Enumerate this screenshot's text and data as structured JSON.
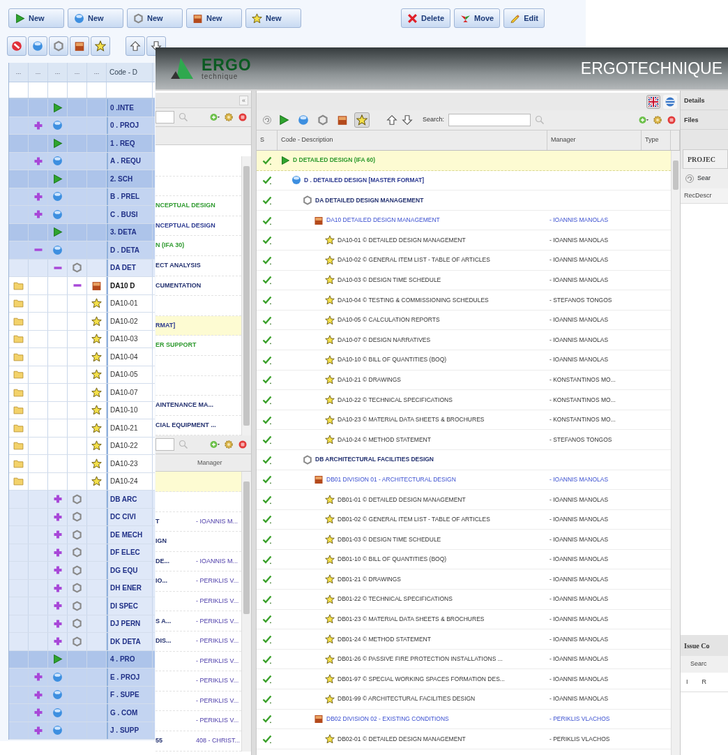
{
  "back_window": {
    "new_buttons": [
      {
        "kind": "phase",
        "label": "New"
      },
      {
        "kind": "group",
        "label": "New"
      },
      {
        "kind": "section",
        "label": "New"
      },
      {
        "kind": "package",
        "label": "New"
      },
      {
        "kind": "item",
        "label": "New"
      }
    ],
    "action_buttons": [
      {
        "kind": "delete",
        "label": "Delete"
      },
      {
        "kind": "move",
        "label": "Move"
      },
      {
        "kind": "edit",
        "label": "Edit"
      }
    ],
    "filter_buttons": [
      {
        "kind": "stop"
      },
      {
        "kind": "group"
      },
      {
        "kind": "section"
      },
      {
        "kind": "package"
      },
      {
        "kind": "item"
      }
    ],
    "order_buttons": [
      {
        "kind": "up"
      },
      {
        "kind": "down"
      }
    ],
    "grid": {
      "columns": [
        "...",
        "...",
        "...",
        "...",
        "...",
        "Code - D"
      ],
      "rows": [
        {
          "kind": "phase",
          "text": "0 .INTE"
        },
        {
          "kind": "group",
          "text": "0 . PROJ",
          "expanded": false
        },
        {
          "kind": "phase",
          "text": "1 . REQ"
        },
        {
          "kind": "group",
          "text": "A . REQU",
          "expanded": false
        },
        {
          "kind": "phase",
          "text": "2. SCH"
        },
        {
          "kind": "group",
          "text": "B . PREL",
          "expanded": false
        },
        {
          "kind": "group",
          "text": "C . BUSI",
          "expanded": false
        },
        {
          "kind": "phase",
          "text": "3. DETA"
        },
        {
          "kind": "group",
          "text": "D . DETA",
          "expanded": true,
          "children": [
            {
              "kind": "section",
              "text": "DA DET",
              "expanded": true,
              "children": [
                {
                  "kind": "package",
                  "text": "DA10 D",
                  "expanded": true,
                  "children": [
                    {
                      "kind": "item",
                      "text": "DA10-01"
                    },
                    {
                      "kind": "item",
                      "text": "DA10-02"
                    },
                    {
                      "kind": "item",
                      "text": "DA10-03"
                    },
                    {
                      "kind": "item",
                      "text": "DA10-04"
                    },
                    {
                      "kind": "item",
                      "text": "DA10-05"
                    },
                    {
                      "kind": "item",
                      "text": "DA10-07"
                    },
                    {
                      "kind": "item",
                      "text": "DA10-10"
                    },
                    {
                      "kind": "item",
                      "text": "DA10-21"
                    },
                    {
                      "kind": "item",
                      "text": "DA10-22"
                    },
                    {
                      "kind": "item",
                      "text": "DA10-23"
                    },
                    {
                      "kind": "item",
                      "text": "DA10-24"
                    }
                  ]
                }
              ]
            },
            {
              "kind": "section",
              "text": "DB ARC",
              "expanded": false
            },
            {
              "kind": "section",
              "text": "DC CIVI",
              "expanded": false
            },
            {
              "kind": "section",
              "text": "DE MECH",
              "expanded": false
            },
            {
              "kind": "section",
              "text": "DF ELEC",
              "expanded": false
            },
            {
              "kind": "section",
              "text": "DG EQU",
              "expanded": false
            },
            {
              "kind": "section",
              "text": "DH ENER",
              "expanded": false
            },
            {
              "kind": "section",
              "text": "DI SPEC",
              "expanded": false
            },
            {
              "kind": "section",
              "text": "DJ PERN",
              "expanded": false
            },
            {
              "kind": "section",
              "text": "DK DETA",
              "expanded": false
            }
          ]
        },
        {
          "kind": "phase",
          "text": "4 . PRO"
        },
        {
          "kind": "group",
          "text": "E . PROJ",
          "expanded": false
        },
        {
          "kind": "group",
          "text": "F . SUPE",
          "expanded": false
        },
        {
          "kind": "group",
          "text": "G . COM",
          "expanded": false
        },
        {
          "kind": "group",
          "text": "J . SUPP",
          "expanded": false
        }
      ]
    }
  },
  "front_window": {
    "brand": {
      "logo_word": "ERGO",
      "logo_subword": "technique",
      "title": "ERGOTECHNIQUE"
    },
    "tree_panel": {
      "collapse_label": "«",
      "rows": [
        {
          "selected": false
        },
        {
          "selected": false
        },
        {
          "kind": "phase",
          "text": "NCEPTUAL DESIGN",
          "selected": false
        },
        {
          "kind": "group",
          "text": "NCEPTUAL DESIGN",
          "selected": false
        },
        {
          "kind": "phase",
          "text": "N (IFA 30)",
          "selected": false
        },
        {
          "kind": "section",
          "text": "ECT ANALYSIS",
          "selected": false
        },
        {
          "kind": "section",
          "text": "CUMENTATION",
          "selected": false
        },
        {
          "selected": false
        },
        {
          "kind": "group",
          "text": "RMAT]",
          "selected": true
        },
        {
          "kind": "phase",
          "text": "ER SUPPORT",
          "selected": false
        },
        {
          "selected": false
        },
        {
          "selected": false
        },
        {
          "kind": "section",
          "text": "AINTENANCE MA...",
          "selected": false
        },
        {
          "kind": "section",
          "text": "CIAL EQUIPMENT ...",
          "selected": false
        }
      ]
    },
    "list_panel": {
      "columns": [
        "Manager"
      ],
      "rows": [
        {
          "selected": true
        },
        {
          "selected": false
        },
        {
          "code": "T",
          "manager": "- IOANNIS M...",
          "selected": false
        },
        {
          "code": "IGN",
          "selected": false
        },
        {
          "code": "DE...",
          "manager": "- IOANNIS M...",
          "selected": false
        },
        {
          "code": "IO...",
          "manager": "- PERIKLIS V...",
          "selected": false
        },
        {
          "manager": "- PERIKLIS V...",
          "selected": false
        },
        {
          "code": "S A...",
          "manager": "- PERIKLIS V...",
          "selected": false
        },
        {
          "code": "DIS...",
          "manager": "- PERIKLIS V...",
          "selected": false
        },
        {
          "manager": "- PERIKLIS V...",
          "selected": false
        },
        {
          "manager": "- PERIKLIS V...",
          "selected": false
        },
        {
          "manager": "- PERIKLIS V...",
          "selected": false
        },
        {
          "manager": "- PERIKLIS V...",
          "selected": false
        },
        {
          "code": "55",
          "manager": "408 - CHRIST...",
          "selected": false
        }
      ]
    },
    "main_panel": {
      "languages": [
        {
          "kind": "uk",
          "selected": true
        },
        {
          "kind": "gr",
          "selected": false
        }
      ],
      "filter_buttons": [
        {
          "kind": "phase",
          "selected": false
        },
        {
          "kind": "group",
          "selected": false
        },
        {
          "kind": "section",
          "selected": false
        },
        {
          "kind": "package",
          "selected": false
        },
        {
          "kind": "item",
          "selected": true
        }
      ],
      "order_buttons": [
        {
          "kind": "up"
        },
        {
          "kind": "down"
        }
      ],
      "search": {
        "label": "Search:"
      },
      "columns": [
        "S",
        "Code - Description",
        "Manager",
        "Type"
      ],
      "rows": [
        {
          "kind": "phase",
          "text": "D DETAILED DESIGN (IFA 60)",
          "done": true,
          "selected": true,
          "children": [
            {
              "kind": "group",
              "text": "D . DETAILED DESIGN [MASTER FORMAT]",
              "done": true,
              "selected": false,
              "children": [
                {
                  "kind": "section",
                  "text": "DA DETAILED DESIGN MANAGEMENT",
                  "done": true,
                  "selected": false,
                  "children": [
                    {
                      "kind": "package",
                      "text": "DA10 DETAILED DESIGN MANAGEMENT",
                      "manager": "- IOANNIS MANOLAS",
                      "done": true,
                      "selected": false,
                      "children": [
                        {
                          "kind": "item",
                          "text": "DA10-01 © DETAILED DESIGN MANAGEMENT",
                          "manager": "- IOANNIS MANOLAS",
                          "done": true,
                          "selected": false
                        },
                        {
                          "kind": "item",
                          "text": "DA10-02 © GENERAL ITEM LIST - TABLE OF ARTICLES",
                          "manager": "- IOANNIS MANOLAS",
                          "done": true,
                          "selected": false
                        },
                        {
                          "kind": "item",
                          "text": "DA10-03 © DESIGN TIME SCHEDULE",
                          "manager": "- IOANNIS MANOLAS",
                          "done": true,
                          "selected": false
                        },
                        {
                          "kind": "item",
                          "text": "DA10-04 © TESTING & COMMISSIONING SCHEDULES",
                          "manager": "- STEFANOS TONGOS",
                          "done": true,
                          "selected": false
                        },
                        {
                          "kind": "item",
                          "text": "DA10-05 © CALCULATION REPORTS",
                          "manager": "- IOANNIS MANOLAS",
                          "done": true,
                          "selected": false
                        },
                        {
                          "kind": "item",
                          "text": "DA10-07 © DESIGN NARRATIVES",
                          "manager": "- IOANNIS MANOLAS",
                          "done": true,
                          "selected": false
                        },
                        {
                          "kind": "item",
                          "text": "DA10-10 © BILL OF QUANTITIES (BOQ)",
                          "manager": "- IOANNIS MANOLAS",
                          "done": true,
                          "selected": false
                        },
                        {
                          "kind": "item",
                          "text": "DA10-21 © DRAWINGS",
                          "manager": "- KONSTANTINOS MO...",
                          "done": true,
                          "selected": false
                        },
                        {
                          "kind": "item",
                          "text": "DA10-22 © TECHNICAL SPECIFICATIONS",
                          "manager": "- KONSTANTINOS MO...",
                          "done": true,
                          "selected": false
                        },
                        {
                          "kind": "item",
                          "text": "DA10-23 © MATERIAL DATA SHEETS & BROCHURES",
                          "manager": "- KONSTANTINOS MO...",
                          "done": true,
                          "selected": false
                        },
                        {
                          "kind": "item",
                          "text": "DA10-24 © METHOD STATEMENT",
                          "manager": "- STEFANOS TONGOS",
                          "done": true,
                          "selected": false
                        }
                      ]
                    }
                  ]
                },
                {
                  "kind": "section",
                  "text": "DB ARCHITECTURAL FACILITIES DESIGN",
                  "done": true,
                  "selected": false,
                  "children": [
                    {
                      "kind": "package",
                      "text": "DB01 DIVISION 01 - ARCHITECTURAL DESIGN",
                      "manager": "- IOANNIS MANOLAS",
                      "done": true,
                      "selected": false,
                      "children": [
                        {
                          "kind": "item",
                          "text": "DB01-01 © DETAILED DESIGN MANAGEMENT",
                          "manager": "- IOANNIS MANOLAS",
                          "done": true,
                          "selected": false
                        },
                        {
                          "kind": "item",
                          "text": "DB01-02 © GENERAL ITEM LIST - TABLE OF ARTICLES",
                          "manager": "- IOANNIS MANOLAS",
                          "done": true,
                          "selected": false
                        },
                        {
                          "kind": "item",
                          "text": "DB01-03 © DESIGN TIME SCHEDULE",
                          "manager": "- IOANNIS MANOLAS",
                          "done": true,
                          "selected": false
                        },
                        {
                          "kind": "item",
                          "text": "DB01-10 © BILL OF QUANTITIES (BOQ)",
                          "manager": "- IOANNIS MANOLAS",
                          "done": true,
                          "selected": false
                        },
                        {
                          "kind": "item",
                          "text": "DB01-21 © DRAWINGS",
                          "manager": "- IOANNIS MANOLAS",
                          "done": true,
                          "selected": false
                        },
                        {
                          "kind": "item",
                          "text": "DB01-22 © TECHNICAL SPECIFICATIONS",
                          "manager": "- IOANNIS MANOLAS",
                          "done": true,
                          "selected": false
                        },
                        {
                          "kind": "item",
                          "text": "DB01-23 © MATERIAL DATA SHEETS & BROCHURES",
                          "manager": "- IOANNIS MANOLAS",
                          "done": true,
                          "selected": false
                        },
                        {
                          "kind": "item",
                          "text": "DB01-24 © METHOD STATEMENT",
                          "manager": "- IOANNIS MANOLAS",
                          "done": true,
                          "selected": false
                        },
                        {
                          "kind": "item",
                          "text": "DB01-26 © PASSIVE FIRE PROTECTION INSTALLATIONS ...",
                          "manager": "- IOANNIS MANOLAS",
                          "done": true,
                          "selected": false
                        },
                        {
                          "kind": "item",
                          "text": "DB01-97 © SPECIAL WORKING SPACES FORMATION DES...",
                          "manager": "- IOANNIS MANOLAS",
                          "done": true,
                          "selected": false
                        },
                        {
                          "kind": "item",
                          "text": "DB01-99 © ARCHITECTURAL FACILITIES DESIGN",
                          "manager": "- IOANNIS MANOLAS",
                          "done": true,
                          "selected": false
                        }
                      ]
                    },
                    {
                      "kind": "package",
                      "text": "DB02 DIVISION 02 - EXISTING CONDITIONS",
                      "manager": "- PERIKLIS VLACHOS",
                      "done": true,
                      "selected": false,
                      "children": [
                        {
                          "kind": "item",
                          "text": "DB02-01 © DETAILED DESIGN MANAGEMENT",
                          "manager": "- PERIKLIS VLACHOS",
                          "done": true,
                          "selected": false
                        }
                      ]
                    }
                  ]
                }
              ]
            }
          ]
        }
      ]
    },
    "side_panel": {
      "sections": [
        "Details",
        "Files"
      ],
      "tab": "PROJEC",
      "search_label": "Sear",
      "column": "RecDescr",
      "issue_panel": {
        "title": "Issue Co",
        "search_label": "Searc",
        "columns": [
          "I",
          "R"
        ]
      }
    }
  }
}
